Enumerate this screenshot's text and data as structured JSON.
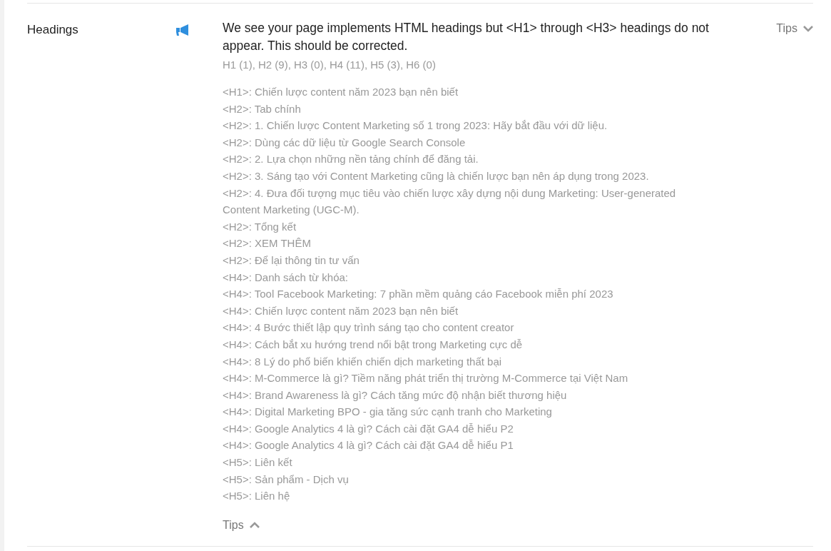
{
  "section": {
    "label": "Headings",
    "message": "We see your page implements HTML headings but <H1> through <H3> headings do not appear. This should be corrected.",
    "counts": "H1 (1), H2 (9), H3 (0), H4 (11), H5 (3), H6 (0)",
    "headings": [
      "<H1>: Chiến lược content năm 2023 bạn nên biết",
      "<H2>: Tab chính",
      "<H2>: 1. Chiến lược Content Marketing số 1 trong 2023: Hãy bắt đầu với dữ liệu.",
      "<H2>: Dùng các dữ liệu từ Google Search Console",
      "<H2>: 2. Lựa chọn những nền tảng chính để đăng tải.",
      "<H2>: 3. Sáng tạo với Content Marketing cũng là chiến lược bạn nên áp dụng trong 2023.",
      "<H2>: 4. Đưa đối tượng mục tiêu vào chiến lược xây dựng nội dung Marketing: User-generated Content Marketing (UGC-M).",
      "<H2>: Tổng kết",
      "<H2>: XEM THÊM",
      "<H2>: Để lại thông tin tư vấn",
      "<H4>: Danh sách từ khóa:",
      "<H4>: Tool Facebook Marketing: 7 phần mềm quảng cáo Facebook miễn phí 2023",
      "<H4>: Chiến lược content năm 2023 bạn nên biết",
      "<H4>: 4 Bước thiết lập quy trình sáng tạo cho content creator",
      "<H4>: Cách bắt xu hướng trend nổi bật trong Marketing cực dễ",
      "<H4>: 8 Lý do phổ biến khiến chiến dịch marketing thất bại",
      "<H4>: M-Commerce là gì? Tiềm năng phát triển thị trường M-Commerce tại Việt Nam",
      "<H4>: Brand Awareness là gì? Cách tăng mức độ nhận biết thương hiệu",
      "<H4>: Digital Marketing BPO - gia tăng sức cạnh tranh cho Marketing",
      "<H4>: Google Analytics 4 là gì? Cách cài đặt GA4 dễ hiểu P2",
      "<H4>: Google Analytics 4 là gì? Cách cài đặt GA4 dễ hiểu P1",
      "<H5>: Liên kết",
      "<H5>: Sản phẩm - Dịch vụ",
      "<H5>: Liên hệ"
    ],
    "tips_top": {
      "label": "Tips",
      "expanded": false
    },
    "tips_bottom": {
      "label": "Tips",
      "expanded": true
    }
  }
}
